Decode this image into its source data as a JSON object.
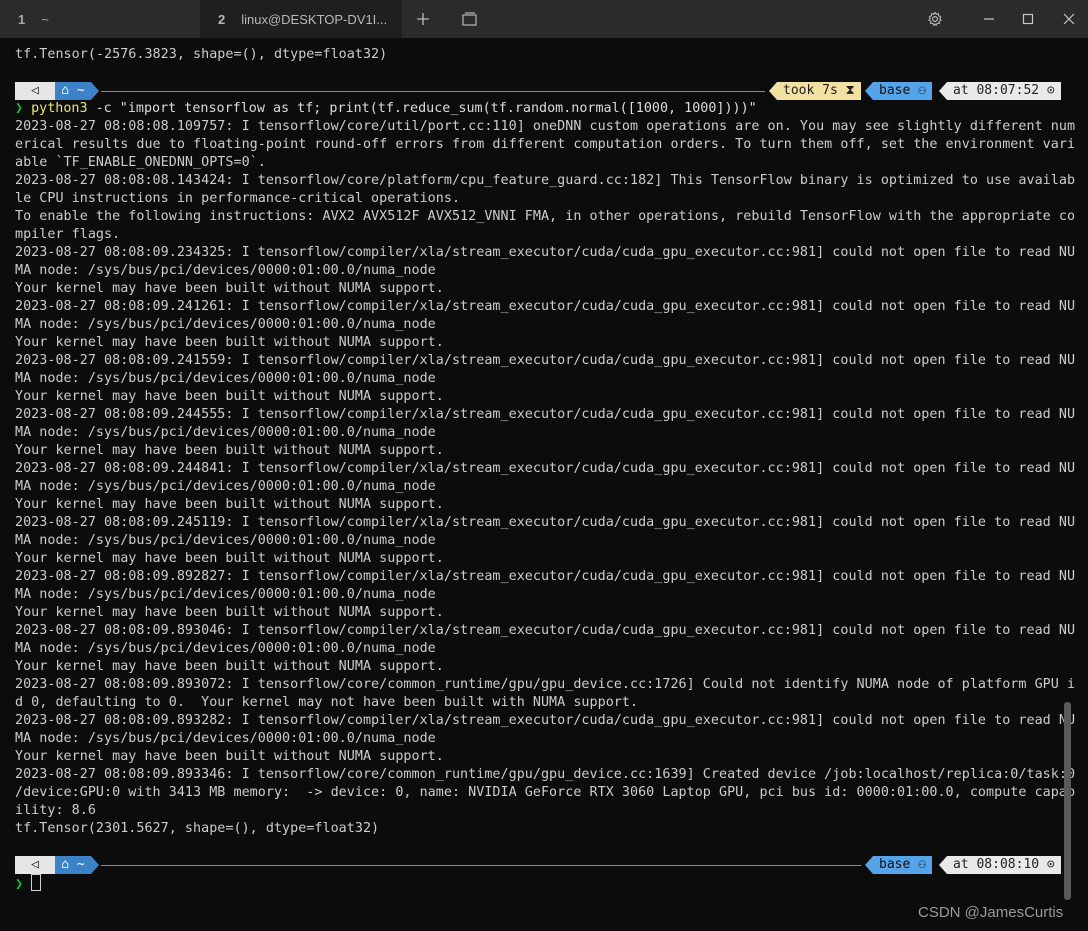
{
  "window": {
    "tabs": [
      {
        "number": "1",
        "label": "~"
      },
      {
        "number": "2",
        "label": "linux@DESKTOP-DV1I..."
      }
    ],
    "icons": {
      "new_tab": "plus-icon",
      "tab_switcher": "window-tabs-icon",
      "settings": "gear-icon",
      "minimize": "minimize-icon",
      "maximize": "maximize-icon",
      "close": "close-icon"
    }
  },
  "terminal": {
    "previous_output": "tf.Tensor(-2576.3823, shape=(), dtype=float32)",
    "prompt1": {
      "os_glyph": "◁",
      "path": "⌂ ~",
      "took": "took 7s ⧗",
      "env": "base ⚇",
      "time": "at 08:07:52 ⊙"
    },
    "command": {
      "chevron": "❯",
      "program": "python3",
      "args": " -c \"import tensorflow as tf; print(tf.reduce_sum(tf.random.normal([1000, 1000])))\""
    },
    "output_lines": [
      "2023-08-27 08:08:08.109757: I tensorflow/core/util/port.cc:110] oneDNN custom operations are on. You may see slightly different num",
      "erical results due to floating-point round-off errors from different computation orders. To turn them off, set the environment vari",
      "able `TF_ENABLE_ONEDNN_OPTS=0`.",
      "2023-08-27 08:08:08.143424: I tensorflow/core/platform/cpu_feature_guard.cc:182] This TensorFlow binary is optimized to use availab",
      "le CPU instructions in performance-critical operations.",
      "To enable the following instructions: AVX2 AVX512F AVX512_VNNI FMA, in other operations, rebuild TensorFlow with the appropriate co",
      "mpiler flags.",
      "2023-08-27 08:08:09.234325: I tensorflow/compiler/xla/stream_executor/cuda/cuda_gpu_executor.cc:981] could not open file to read NU",
      "MA node: /sys/bus/pci/devices/0000:01:00.0/numa_node",
      "Your kernel may have been built without NUMA support.",
      "2023-08-27 08:08:09.241261: I tensorflow/compiler/xla/stream_executor/cuda/cuda_gpu_executor.cc:981] could not open file to read NU",
      "MA node: /sys/bus/pci/devices/0000:01:00.0/numa_node",
      "Your kernel may have been built without NUMA support.",
      "2023-08-27 08:08:09.241559: I tensorflow/compiler/xla/stream_executor/cuda/cuda_gpu_executor.cc:981] could not open file to read NU",
      "MA node: /sys/bus/pci/devices/0000:01:00.0/numa_node",
      "Your kernel may have been built without NUMA support.",
      "2023-08-27 08:08:09.244555: I tensorflow/compiler/xla/stream_executor/cuda/cuda_gpu_executor.cc:981] could not open file to read NU",
      "MA node: /sys/bus/pci/devices/0000:01:00.0/numa_node",
      "Your kernel may have been built without NUMA support.",
      "2023-08-27 08:08:09.244841: I tensorflow/compiler/xla/stream_executor/cuda/cuda_gpu_executor.cc:981] could not open file to read NU",
      "MA node: /sys/bus/pci/devices/0000:01:00.0/numa_node",
      "Your kernel may have been built without NUMA support.",
      "2023-08-27 08:08:09.245119: I tensorflow/compiler/xla/stream_executor/cuda/cuda_gpu_executor.cc:981] could not open file to read NU",
      "MA node: /sys/bus/pci/devices/0000:01:00.0/numa_node",
      "Your kernel may have been built without NUMA support.",
      "2023-08-27 08:08:09.892827: I tensorflow/compiler/xla/stream_executor/cuda/cuda_gpu_executor.cc:981] could not open file to read NU",
      "MA node: /sys/bus/pci/devices/0000:01:00.0/numa_node",
      "Your kernel may have been built without NUMA support.",
      "2023-08-27 08:08:09.893046: I tensorflow/compiler/xla/stream_executor/cuda/cuda_gpu_executor.cc:981] could not open file to read NU",
      "MA node: /sys/bus/pci/devices/0000:01:00.0/numa_node",
      "Your kernel may have been built without NUMA support.",
      "2023-08-27 08:08:09.893072: I tensorflow/core/common_runtime/gpu/gpu_device.cc:1726] Could not identify NUMA node of platform GPU i",
      "d 0, defaulting to 0.  Your kernel may not have been built with NUMA support.",
      "2023-08-27 08:08:09.893282: I tensorflow/compiler/xla/stream_executor/cuda/cuda_gpu_executor.cc:981] could not open file to read NU",
      "MA node: /sys/bus/pci/devices/0000:01:00.0/numa_node",
      "Your kernel may have been built without NUMA support.",
      "2023-08-27 08:08:09.893346: I tensorflow/core/common_runtime/gpu/gpu_device.cc:1639] Created device /job:localhost/replica:0/task:0",
      "/device:GPU:0 with 3413 MB memory:  -> device: 0, name: NVIDIA GeForce RTX 3060 Laptop GPU, pci bus id: 0000:01:00.0, compute capab",
      "ility: 8.6",
      "tf.Tensor(2301.5627, shape=(), dtype=float32)"
    ],
    "prompt2": {
      "os_glyph": "◁",
      "path": "⌂ ~",
      "env": "base ⚇",
      "time": "at 08:08:10 ⊙"
    },
    "input_chevron": "❯"
  },
  "watermark": "CSDN @JamesCurtis",
  "colors": {
    "background": "#0c0c0c",
    "text": "#cccccc",
    "prompt_path": "#3b82c6",
    "prompt_env": "#55a3e8",
    "prompt_took": "#f3e1a3",
    "chevron": "#13c13a",
    "command": "#e5e57a"
  }
}
